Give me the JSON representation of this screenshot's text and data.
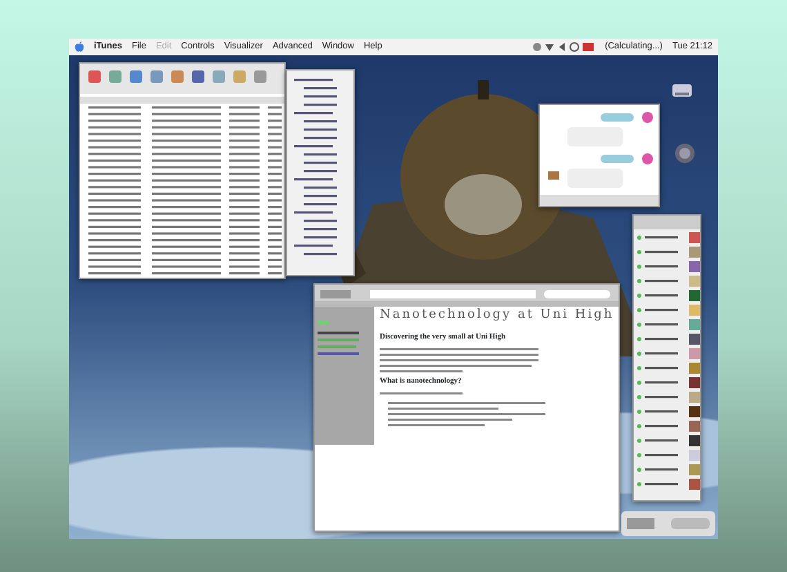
{
  "menu_bar": {
    "app": "iTunes",
    "items": [
      {
        "label": "File",
        "disabled": false
      },
      {
        "label": "Edit",
        "disabled": true
      },
      {
        "label": "Controls",
        "disabled": false
      },
      {
        "label": "Visualizer",
        "disabled": false
      },
      {
        "label": "Advanced",
        "disabled": false
      },
      {
        "label": "Window",
        "disabled": false
      },
      {
        "label": "Help",
        "disabled": false
      }
    ],
    "status": "(Calculating...)",
    "clock": "Tue 21:12"
  },
  "browser": {
    "heading": "Nanotechnology at Uni High",
    "subheading": "Discovering the very small at Uni High",
    "section_heading": "What is nanotechnology?"
  }
}
